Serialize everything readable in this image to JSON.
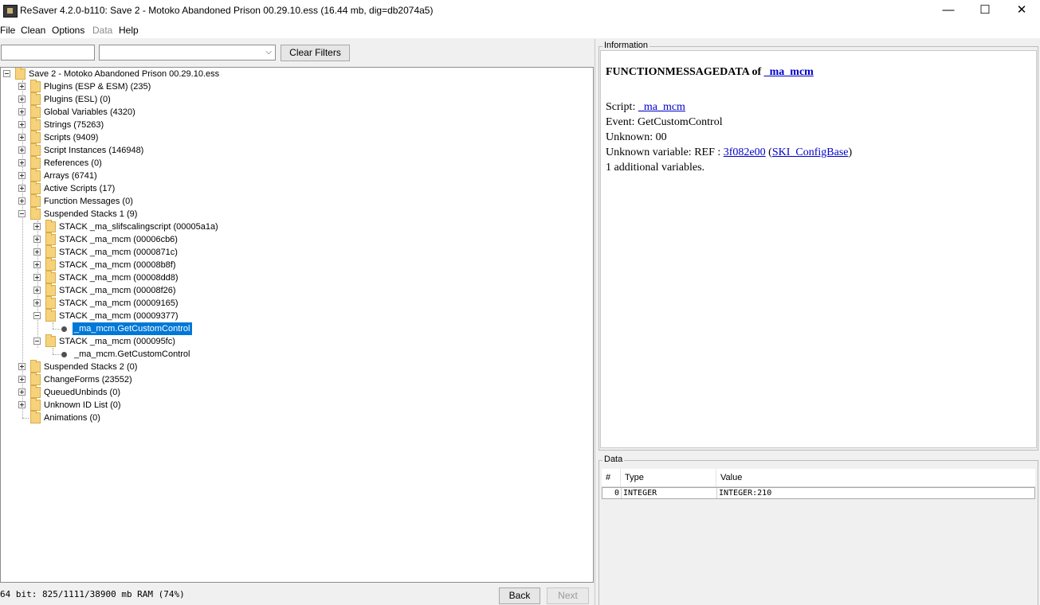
{
  "window": {
    "title": "ReSaver 4.2.0-b110: Save 2 - Motoko  Abandoned Prison  00.29.10.ess (16.44 mb, dig=db2074a5)",
    "controls": {
      "minimize": "—",
      "maximize": "☐",
      "close": "✕"
    }
  },
  "menu": {
    "file": "File",
    "clean": "Clean",
    "options": "Options",
    "data": "Data",
    "help": "Help"
  },
  "filter": {
    "text_value": "",
    "combo_value": "",
    "clear_button": "Clear Filters"
  },
  "tree": {
    "root": "Save 2 - Motoko  Abandoned Prison  00.29.10.ess",
    "nodes": [
      "Plugins (ESP & ESM) (235)",
      "Plugins (ESL) (0)",
      "Global Variables (4320)",
      "Strings (75263)",
      "Scripts (9409)",
      "Script Instances (146948)",
      "References (0)",
      "Arrays (6741)",
      "Active Scripts (17)",
      "Function Messages (0)",
      "Suspended Stacks 1 (9)",
      "Suspended Stacks 2 (0)",
      "ChangeForms (23552)",
      "QueuedUnbinds (0)",
      "Unknown ID List (0)",
      "Animations (0)"
    ],
    "stacks": [
      "STACK _ma_slifscalingscript (00005a1a)",
      "STACK _ma_mcm (00006cb6)",
      "STACK _ma_mcm (0000871c)",
      "STACK _ma_mcm (00008b8f)",
      "STACK _ma_mcm (00008dd8)",
      "STACK _ma_mcm (00008f26)",
      "STACK _ma_mcm (00009165)",
      "STACK _ma_mcm (00009377)",
      "STACK _ma_mcm (000095fc)"
    ],
    "leaf_selected": "_ma_mcm.GetCustomControl",
    "leaf_other": "_ma_mcm.GetCustomControl"
  },
  "status": {
    "ram": "64 bit: 825/1111/38900 mb RAM (74%)",
    "back": "Back",
    "next": "Next"
  },
  "info": {
    "group_title": "Information",
    "heading_prefix": "FUNCTIONMESSAGEDATA of ",
    "heading_link": "_ma_mcm",
    "script_label": "Script: ",
    "script_link": "_ma_mcm",
    "event": "Event: GetCustomControl",
    "unknown": "Unknown: 00",
    "unknown_var_prefix": "Unknown variable: REF : ",
    "ref_link": "3f082e00",
    "paren_open": " (",
    "config_link": "SKI_ConfigBase",
    "paren_close": ")",
    "additional": "1 additional variables."
  },
  "data_table": {
    "group_title": "Data",
    "headers": {
      "num": "#",
      "type": "Type",
      "value": "Value"
    },
    "row": {
      "num": "0",
      "type": "INTEGER",
      "value": "INTEGER:210"
    }
  },
  "colors": {
    "selection": "#0078d7",
    "link": "#0000c8",
    "folder": "#f6d37a"
  }
}
